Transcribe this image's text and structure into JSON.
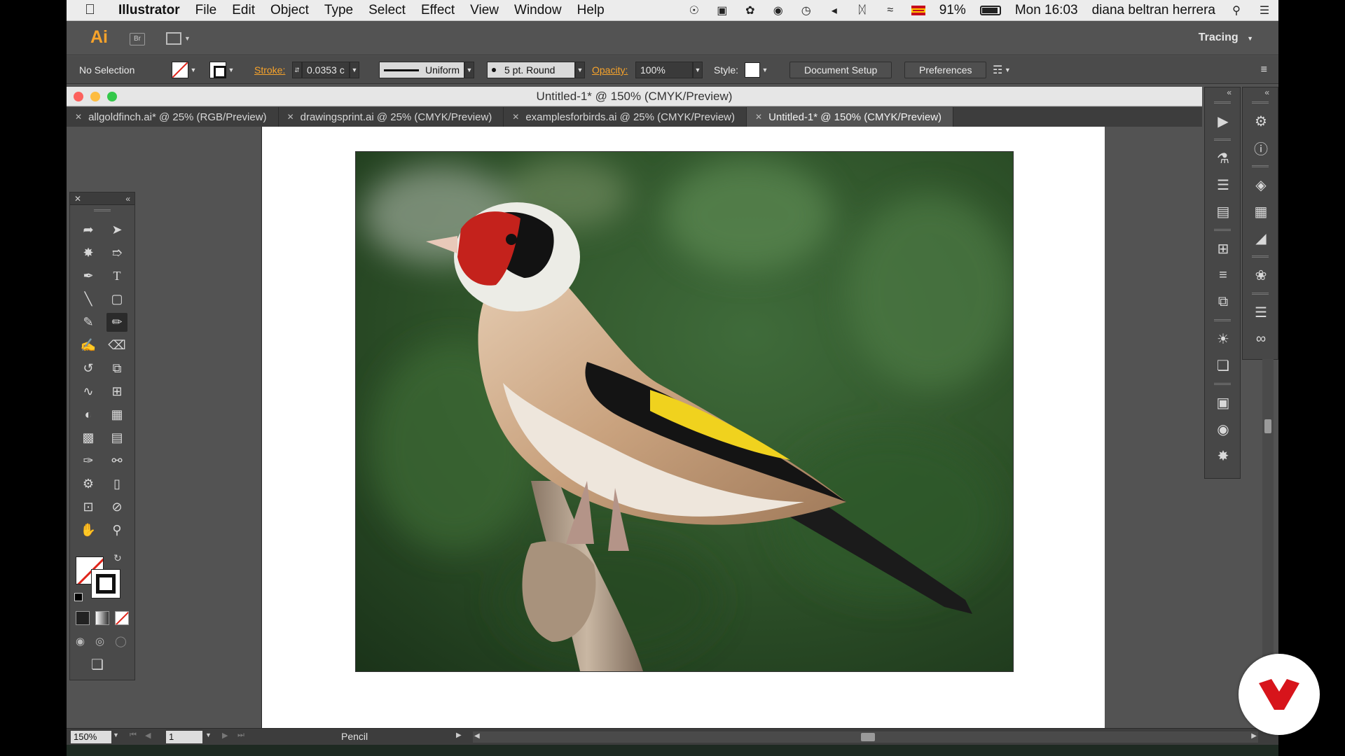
{
  "menubar": {
    "app_name": "Illustrator",
    "items": [
      "File",
      "Edit",
      "Object",
      "Type",
      "Select",
      "Effect",
      "View",
      "Window",
      "Help"
    ],
    "battery": "91%",
    "clock": "Mon 16:03",
    "user": "diana beltran herrera"
  },
  "appbar": {
    "logo": "Ai",
    "bridge": "Br",
    "workspace": "Tracing"
  },
  "controlbar": {
    "selection": "No Selection",
    "stroke_label": "Stroke:",
    "stroke_value": "0.0353 c",
    "profile": "Uniform",
    "brush": "5 pt. Round",
    "opacity_label": "Opacity:",
    "opacity_value": "100%",
    "style_label": "Style:",
    "document_setup": "Document Setup",
    "preferences": "Preferences"
  },
  "document": {
    "window_title": "Untitled-1* @ 150% (CMYK/Preview)",
    "tabs": [
      {
        "label": "allgoldfinch.ai* @ 25% (RGB/Preview)",
        "active": false
      },
      {
        "label": "drawingsprint.ai @ 25% (CMYK/Preview)",
        "active": false
      },
      {
        "label": "examplesforbirds.ai @ 25% (CMYK/Preview)",
        "active": false
      },
      {
        "label": "Untitled-1* @ 150% (CMYK/Preview)",
        "active": true
      }
    ]
  },
  "statusbar": {
    "zoom": "150%",
    "page": "1",
    "tool": "Pencil"
  },
  "colors": {
    "accent": "#f7a32b",
    "brand_red": "#d7141b"
  }
}
